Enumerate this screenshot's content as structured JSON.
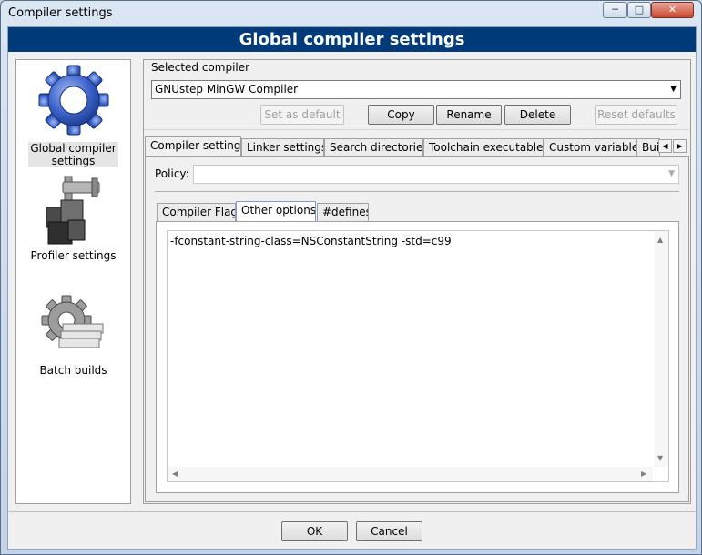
{
  "window": {
    "title": "Compiler settings",
    "controls": {
      "minimize": "─",
      "maximize": "□",
      "close": "✕"
    }
  },
  "banner": {
    "title": "Global compiler settings"
  },
  "sidebar": {
    "items": [
      {
        "label_line1": "Global compiler",
        "label_line2": "settings",
        "icon": "gear-icon",
        "selected": true
      },
      {
        "label": "Profiler settings",
        "icon": "caliper-icon"
      },
      {
        "label": "Batch builds",
        "icon": "batch-gear-icon"
      }
    ]
  },
  "compiler": {
    "section_label": "Selected compiler",
    "selected": "GNUstep MinGW Compiler",
    "buttons": {
      "set_default": "Set as default",
      "copy": "Copy",
      "rename": "Rename",
      "delete": "Delete",
      "reset_defaults": "Reset defaults"
    }
  },
  "tabs": [
    {
      "label": "Compiler settings",
      "active": true
    },
    {
      "label": "Linker settings"
    },
    {
      "label": "Search directories"
    },
    {
      "label": "Toolchain executables"
    },
    {
      "label": "Custom variables"
    },
    {
      "label": "Bui"
    }
  ],
  "policy": {
    "label": "Policy:",
    "value": ""
  },
  "subtabs": [
    {
      "label": "Compiler Flags"
    },
    {
      "label": "Other options",
      "active": true
    },
    {
      "label": "#defines"
    }
  ],
  "other_options": {
    "text": "-fconstant-string-class=NSConstantString -std=c99"
  },
  "dialog_buttons": {
    "ok": "OK",
    "cancel": "Cancel"
  },
  "colors": {
    "banner": "#003a78",
    "banner_text": "#ffffff",
    "gear_blue": "#3b62c9"
  }
}
